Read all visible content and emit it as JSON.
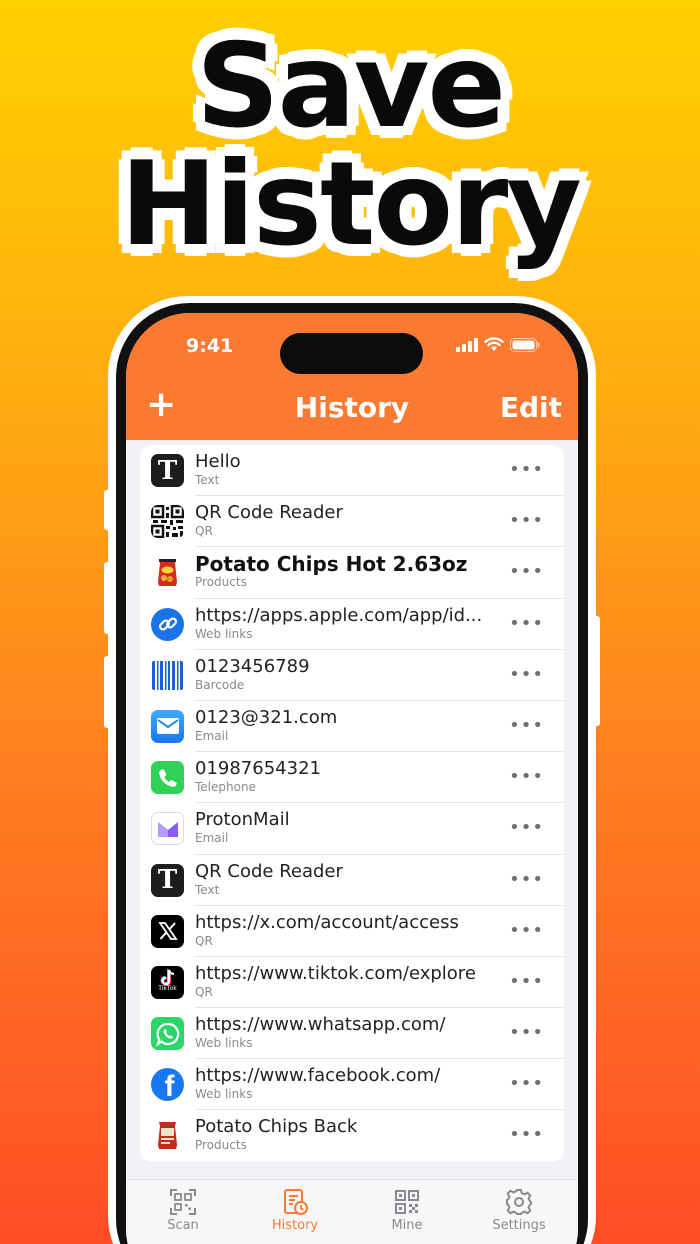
{
  "headline": {
    "line1": "Save",
    "line2": "History"
  },
  "status": {
    "time": "9:41"
  },
  "nav": {
    "add": "+",
    "title": "History",
    "edit": "Edit"
  },
  "items": [
    {
      "title": "Hello",
      "type": "Text",
      "icon": "text-icon"
    },
    {
      "title": "QR Code  Reader",
      "type": "QR",
      "icon": "qr-code-icon"
    },
    {
      "title": "Potato Chips Hot 2.63oz",
      "type": "Products",
      "icon": "chips-bag-icon"
    },
    {
      "title": "https://apps.apple.com/app/id...",
      "type": "Web links",
      "icon": "link-icon"
    },
    {
      "title": "0123456789",
      "type": "Barcode",
      "icon": "barcode-icon"
    },
    {
      "title": "0123@321.com",
      "type": "Email",
      "icon": "mail-icon"
    },
    {
      "title": "01987654321",
      "type": "Telephone",
      "icon": "phone-icon"
    },
    {
      "title": "ProtonMail",
      "type": "Email",
      "icon": "protonmail-icon"
    },
    {
      "title": "QR Code Reader",
      "type": "Text",
      "icon": "text-icon"
    },
    {
      "title": "https://x.com/account/access",
      "type": "QR",
      "icon": "x-logo-icon"
    },
    {
      "title": "https://www.tiktok.com/explore",
      "type": "QR",
      "icon": "tiktok-icon"
    },
    {
      "title": "https://www.whatsapp.com/",
      "type": "Web links",
      "icon": "whatsapp-icon"
    },
    {
      "title": "https://www.facebook.com/",
      "type": "Web links",
      "icon": "facebook-icon"
    },
    {
      "title": "Potato Chips Back",
      "type": "Products",
      "icon": "chips-bag-icon"
    }
  ],
  "more_glyph": "•••",
  "icon_text": {
    "text_glyph": "T",
    "x_glyph": "𝕏",
    "fb_glyph": "f",
    "tiktok_glyph": "TikTok"
  },
  "tabs": [
    {
      "label": "Scan",
      "icon": "scan-icon"
    },
    {
      "label": "History",
      "icon": "history-icon",
      "active": true
    },
    {
      "label": "Mine",
      "icon": "mine-icon"
    },
    {
      "label": "Settings",
      "icon": "gear-icon"
    }
  ],
  "colors": {
    "accent": "#fa7a32",
    "background_top": "#ffd000",
    "background_bottom": "#ff4d25"
  }
}
